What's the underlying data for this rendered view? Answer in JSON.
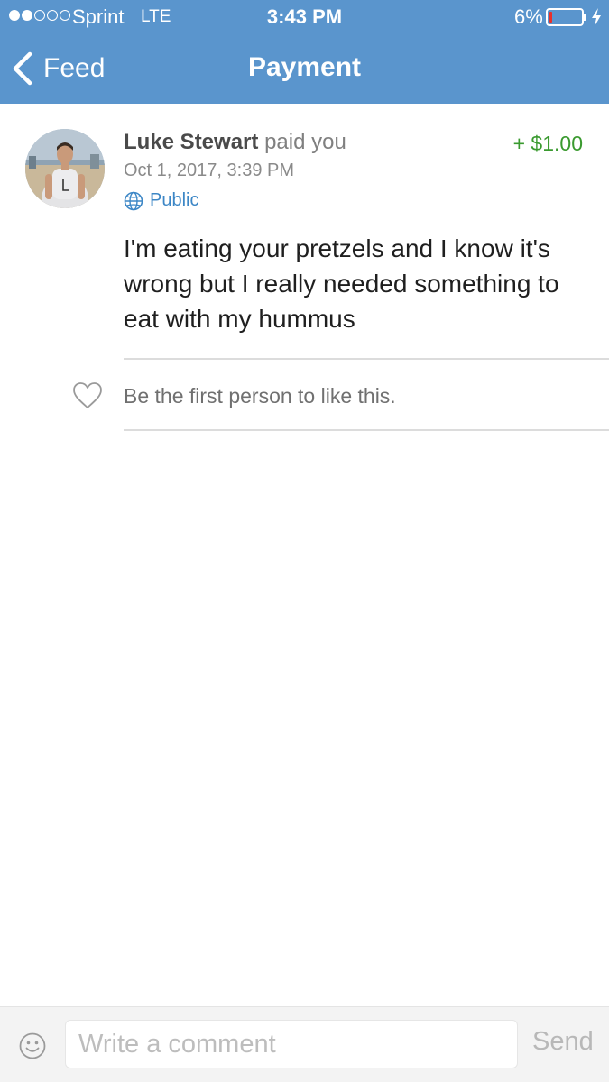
{
  "status_bar": {
    "signal_bars_filled": 2,
    "signal_bars_total": 5,
    "carrier": "Sprint",
    "network": "LTE",
    "time": "3:43 PM",
    "battery_percent": "6%",
    "battery_level": 0.06,
    "battery_color": "#e8302b"
  },
  "nav": {
    "back_label": "Feed",
    "title": "Payment",
    "background": "#5a95cd"
  },
  "payment": {
    "sender": "Luke Stewart",
    "action": "paid you",
    "amount": "+ $1.00",
    "date": "Oct 1, 2017, 3:39 PM",
    "privacy": "Public",
    "privacy_icon": "globe-icon",
    "message": "I'm eating your pretzels and I know it's wrong but I really needed something to eat with my hummus"
  },
  "likes": {
    "icon": "heart-icon",
    "text": "Be the first person to like this."
  },
  "comment_bar": {
    "emoji_icon": "smiley-icon",
    "placeholder": "Write a comment",
    "send_label": "Send"
  }
}
